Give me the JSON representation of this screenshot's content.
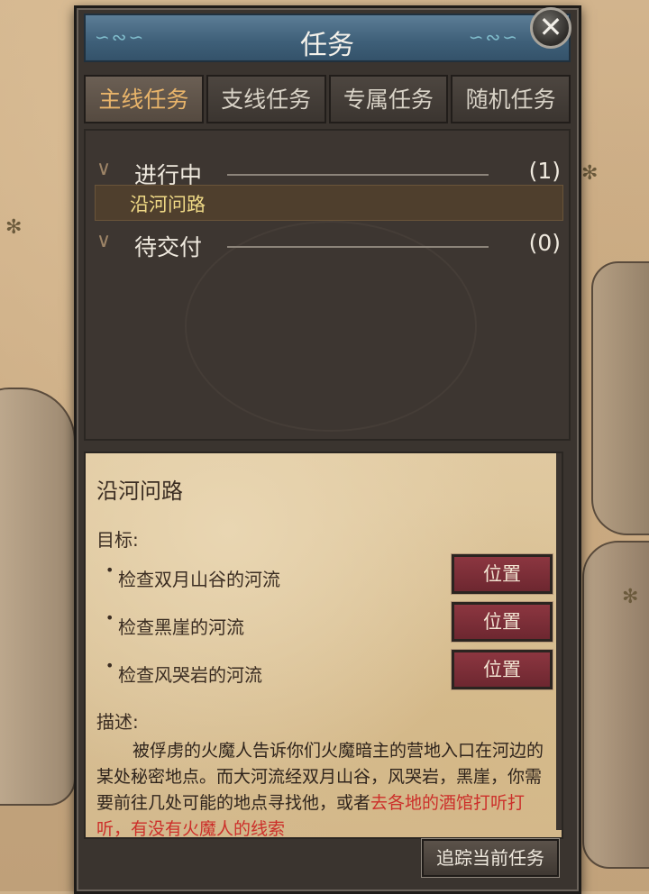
{
  "window": {
    "title": "任务"
  },
  "tabs": [
    {
      "label": "主线任务",
      "active": true
    },
    {
      "label": "支线任务",
      "active": false
    },
    {
      "label": "专属任务",
      "active": false
    },
    {
      "label": "随机任务",
      "active": false
    }
  ],
  "quest_list": {
    "groups": [
      {
        "name": "进行中",
        "count": "(1)"
      },
      {
        "name": "待交付",
        "count": "(0)"
      }
    ],
    "selected_quest": "沿河问路"
  },
  "detail": {
    "title": "沿河问路",
    "objective_label": "目标:",
    "objectives": [
      {
        "text": "检查双月山谷的河流",
        "button": "位置"
      },
      {
        "text": "检查黑崖的河流",
        "button": "位置"
      },
      {
        "text": "检查风哭岩的河流",
        "button": "位置"
      }
    ],
    "description_label": "描述:",
    "description_text": "被俘虏的火魔人告诉你们火魔暗主的营地入口在河边的某处秘密地点。而大河流经双月山谷，风哭岩，黑崖，你需要前往几处可能的地点寻找他，或者",
    "description_highlight": "去各地的酒馆打听打听，有没有火魔人的线索"
  },
  "actions": {
    "track_label": "追踪当前任务"
  },
  "colors": {
    "active_tab": "#e8b46a",
    "selected_quest_text": "#f0da86",
    "highlight_text": "#cc2f2a",
    "location_button": "#8c3640"
  }
}
